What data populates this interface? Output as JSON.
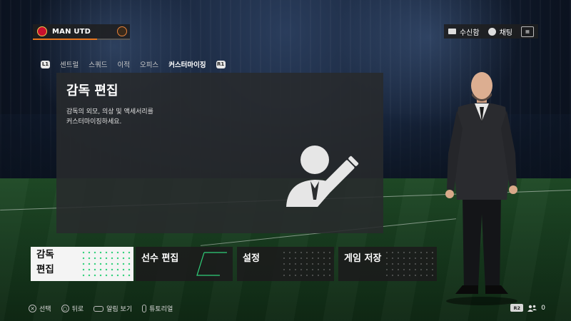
{
  "header": {
    "club_name": "MAN UTD",
    "club_progress_fraction": 0.66,
    "inbox_label": "수신함",
    "chat_label": "채팅"
  },
  "tabs": {
    "left_shoulder": "L1",
    "right_shoulder": "R1",
    "items": [
      {
        "label": "센트럴",
        "active": false
      },
      {
        "label": "스쿼드",
        "active": false
      },
      {
        "label": "이적",
        "active": false
      },
      {
        "label": "오피스",
        "active": false
      },
      {
        "label": "커스터마이징",
        "active": true
      }
    ]
  },
  "panel": {
    "title": "감독 편집",
    "description": "감독의 외모, 의상 및 액세서리를\n커스터마이징하세요."
  },
  "tiles": [
    {
      "label": "감독\n편집",
      "selected": true
    },
    {
      "label": "선수 편집",
      "selected": false
    },
    {
      "label": "설정",
      "selected": false
    },
    {
      "label": "게임 저장",
      "selected": false
    }
  ],
  "hints": [
    {
      "glyph": "✕",
      "label": "선택"
    },
    {
      "glyph": "○",
      "label": "뒤로"
    },
    {
      "glyph": "pad",
      "label": "알림 보기"
    },
    {
      "glyph": "pill",
      "label": "튜토리얼"
    }
  ],
  "footer_right": {
    "r2_label": "R2",
    "friends_count": "0"
  },
  "colors": {
    "accent_orange": "#e8761e",
    "accent_green": "#2fd07a",
    "club_red": "#c8102e"
  }
}
